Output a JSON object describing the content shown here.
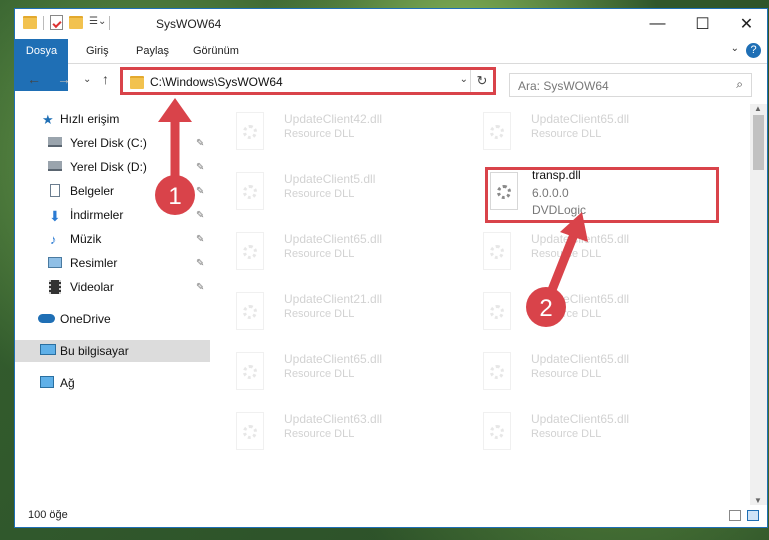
{
  "window": {
    "title": "SysWOW64",
    "minimize": "—",
    "maximize": "☐",
    "close": "✕"
  },
  "ribbon": {
    "tabs": [
      "Dosya",
      "Giriş",
      "Paylaş",
      "Görünüm"
    ],
    "help": "?",
    "collapse": "⌄"
  },
  "nav": {
    "back": "←",
    "forward": "→",
    "recent": "⌄",
    "up": "↑",
    "address": "C:\\Windows\\SysWOW64",
    "address_dropdown": "⌄",
    "refresh": "↻",
    "search_placeholder": "Ara: SysWOW64",
    "search_icon": "⌕"
  },
  "sidebar": {
    "items": [
      {
        "label": "Hızlı erişim",
        "icon": "star-icon",
        "pinned": false
      },
      {
        "label": "Yerel Disk (C:)",
        "icon": "drive-icon",
        "pinned": true
      },
      {
        "label": "Yerel Disk (D:)",
        "icon": "drive-icon",
        "pinned": true
      },
      {
        "label": "Belgeler",
        "icon": "documents-icon",
        "pinned": true
      },
      {
        "label": "İndirmeler",
        "icon": "download-icon",
        "pinned": true
      },
      {
        "label": "Müzik",
        "icon": "music-icon",
        "pinned": true
      },
      {
        "label": "Resimler",
        "icon": "pictures-icon",
        "pinned": true
      },
      {
        "label": "Videolar",
        "icon": "videos-icon",
        "pinned": true
      },
      {
        "label": "OneDrive",
        "icon": "cloud-icon",
        "pinned": false
      },
      {
        "label": "Bu bilgisayar",
        "icon": "computer-icon",
        "pinned": false,
        "selected": true
      },
      {
        "label": "Ağ",
        "icon": "network-icon",
        "pinned": false
      }
    ],
    "pin_glyph": "📌"
  },
  "files": {
    "left": [
      {
        "name": "UpdateClient42.dll",
        "type": "Resource DLL"
      },
      {
        "name": "UpdateClient5.dll",
        "type": "Resource DLL"
      },
      {
        "name": "UpdateClient65.dll",
        "type": "Resource DLL"
      },
      {
        "name": "UpdateClient21.dll",
        "type": "Resource DLL"
      },
      {
        "name": "UpdateClient65.dll",
        "type": "Resource DLL"
      },
      {
        "name": "UpdateClient63.dll",
        "type": "Resource DLL"
      }
    ],
    "right": [
      {
        "name": "UpdateClient65.dll",
        "type": "Resource DLL"
      },
      {
        "name": "UpdateClient65.dll",
        "type": "Resource DLL"
      },
      {
        "name": "UpdateClient65.dll",
        "type": "Resource DLL"
      },
      {
        "name": "UpdateClient65.dll",
        "type": "Resource DLL"
      },
      {
        "name": "UpdateClient65.dll",
        "type": "Resource DLL"
      }
    ],
    "highlighted": {
      "name": "transp.dll",
      "version": "6.0.0.0",
      "company": "DVDLogic"
    }
  },
  "annotations": {
    "step1": "1",
    "step2": "2",
    "color": "#d9434a"
  },
  "status": {
    "count": "100 öğe"
  },
  "colors": {
    "accent": "#1f6fb5",
    "highlight": "#d9434a"
  }
}
